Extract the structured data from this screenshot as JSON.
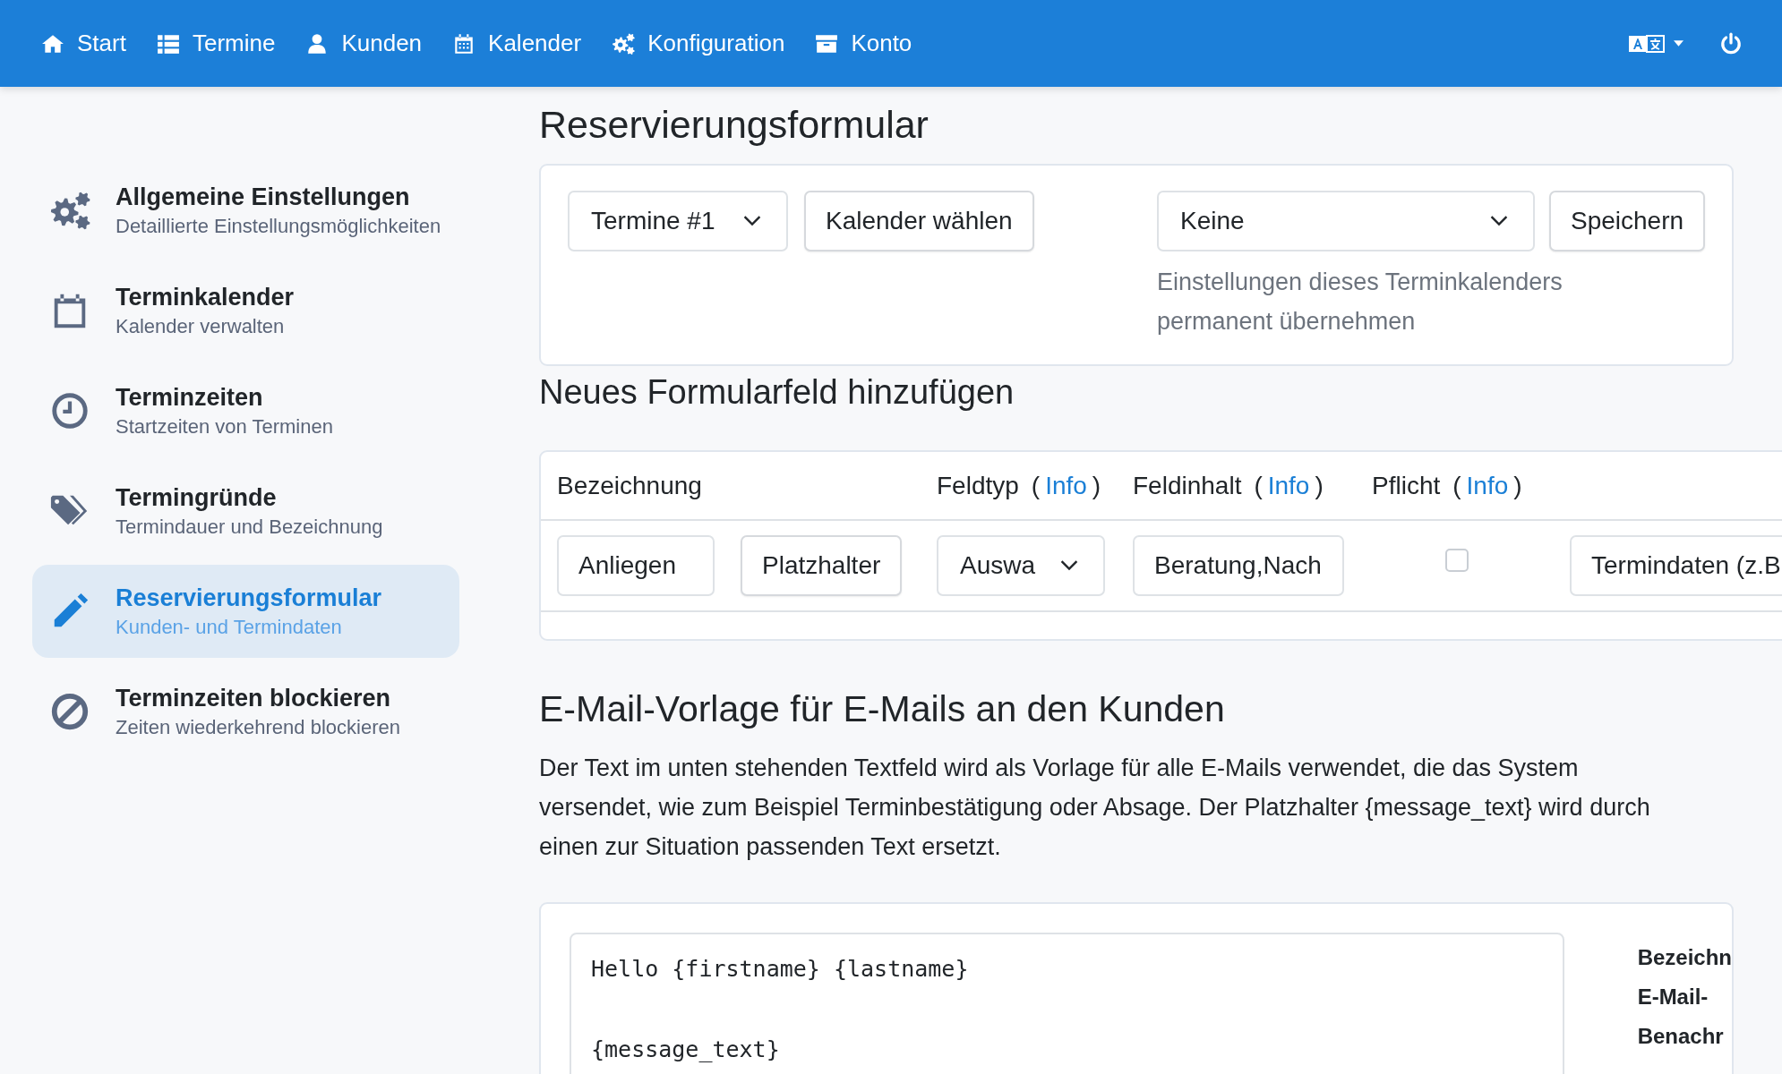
{
  "nav": {
    "items": [
      {
        "kind": "home",
        "label": "Start"
      },
      {
        "kind": "list",
        "label": "Termine"
      },
      {
        "kind": "user",
        "label": "Kunden"
      },
      {
        "kind": "calendar",
        "label": "Kalender"
      },
      {
        "kind": "gears",
        "label": "Konfiguration"
      },
      {
        "kind": "archive",
        "label": "Konto"
      }
    ]
  },
  "sidebar": {
    "items": [
      {
        "kind": "gears",
        "title": "Allgemeine Einstellungen",
        "subtitle": "Detaillierte Einstellungsmöglichkeiten",
        "selected": false
      },
      {
        "kind": "calendar",
        "title": "Terminkalender",
        "subtitle": "Kalender verwalten",
        "selected": false
      },
      {
        "kind": "clock",
        "title": "Terminzeiten",
        "subtitle": "Startzeiten von Terminen",
        "selected": false
      },
      {
        "kind": "tags",
        "title": "Termingründe",
        "subtitle": "Termindauer und Bezeichnung",
        "selected": false
      },
      {
        "kind": "pencil",
        "title": "Reservierungsformular",
        "subtitle": "Kunden- und Termindaten",
        "selected": true
      },
      {
        "kind": "ban",
        "title": "Terminzeiten blockieren",
        "subtitle": "Zeiten wiederkehrend blockieren",
        "selected": false
      }
    ]
  },
  "page_title": "Reservierungsformular",
  "calendar_card": {
    "calendar_select": "Termine #1",
    "choose_button": "Kalender wählen",
    "template_select": "Keine",
    "save_button": "Speichern",
    "hint": "Einstellungen dieses Terminkalenders permanent übernehmen"
  },
  "new_field": {
    "title": "Neues Formularfeld hinzufügen",
    "columns": [
      {
        "label": "Bezeichnung"
      },
      {
        "label": "Feldtyp",
        "open": "(",
        "link": "Info",
        "close": ")"
      },
      {
        "label": "Feldinhalt",
        "open": "(",
        "link": "Info",
        "close": ")"
      },
      {
        "label": "Pflicht",
        "open": "(",
        "link": "Info",
        "close": ")"
      }
    ],
    "row": {
      "name": "Anliegen",
      "placeholder_button": "Platzhalter",
      "type": "Auswa",
      "content": "Beratung,Nach",
      "required": false,
      "column_5": "Termindaten (z.B"
    }
  },
  "email": {
    "title": "E-Mail-Vorlage für E-Mails an den Kunden",
    "description": "Der Text im unten stehenden Textfeld wird als Vorlage für alle E-Mails verwendet, die das System versendet, wie zum Beispiel Terminbestätigung oder Absage. Der Platzhalter {message_text} wird durch einen zur Situation passenden Text ersetzt.",
    "template": "Hello {firstname} {lastname}\n\n{message_text}",
    "side_labels": [
      "Bezeichn",
      "E-Mail-",
      "Benachr"
    ]
  }
}
